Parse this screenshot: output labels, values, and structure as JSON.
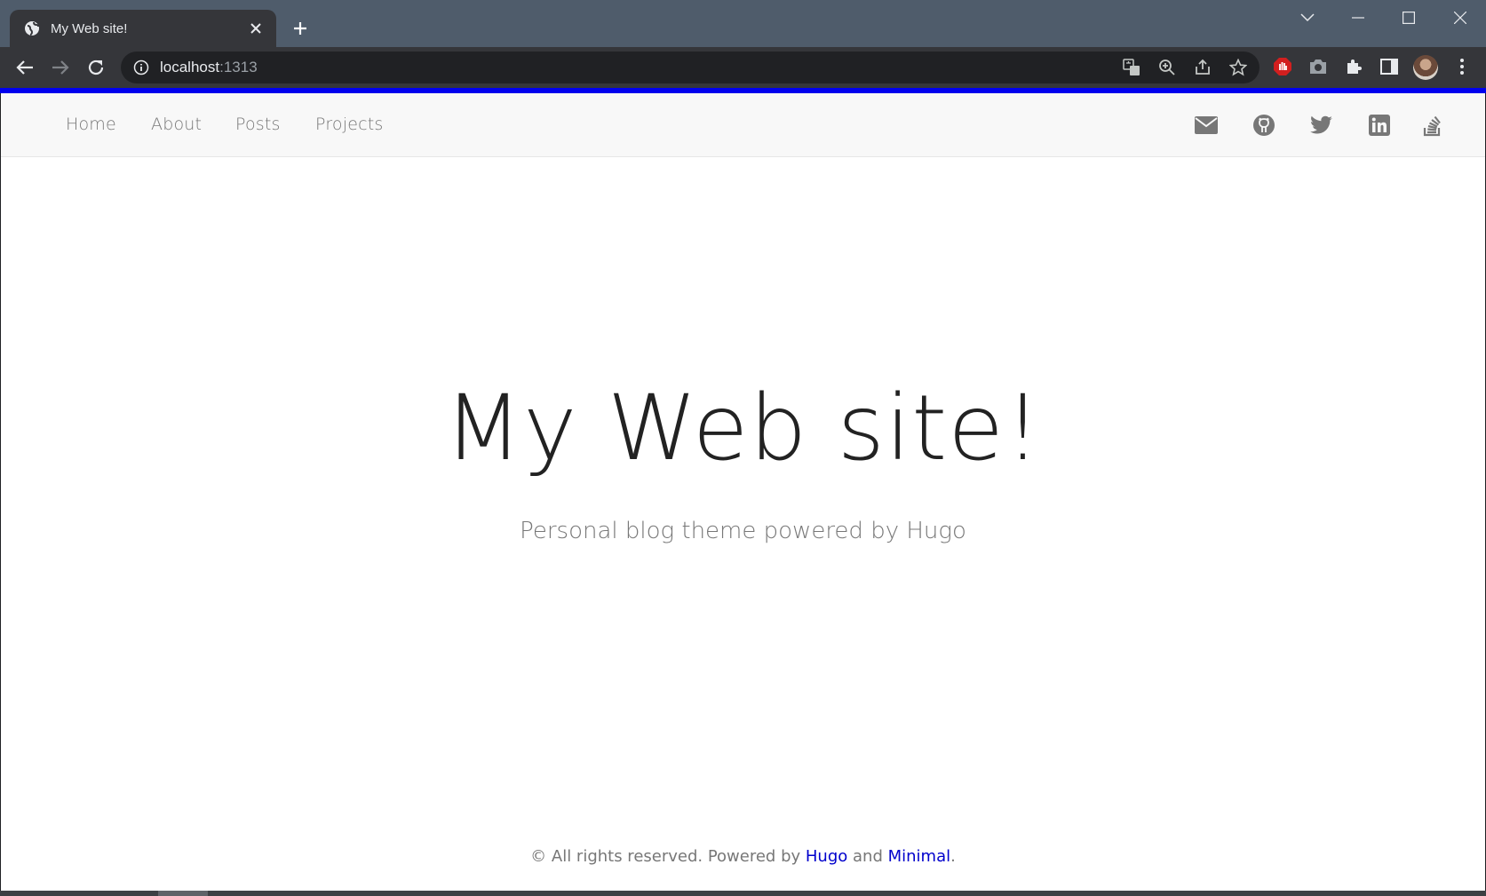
{
  "browser": {
    "tab_title": "My Web site!",
    "url_host": "localhost",
    "url_port": ":1313",
    "accent_color": "#0000ee"
  },
  "nav": {
    "items": [
      {
        "label": "Home"
      },
      {
        "label": "About"
      },
      {
        "label": "Posts"
      },
      {
        "label": "Projects"
      }
    ],
    "social_icons": [
      "envelope-icon",
      "github-icon",
      "twitter-icon",
      "linkedin-icon",
      "stackoverflow-icon"
    ]
  },
  "hero": {
    "title": "My Web site!",
    "subtitle": "Personal blog theme powered by Hugo"
  },
  "footer": {
    "prefix": "© All rights reserved. Powered by ",
    "link1": "Hugo",
    "middle": " and ",
    "link2": "Minimal",
    "suffix": "."
  }
}
